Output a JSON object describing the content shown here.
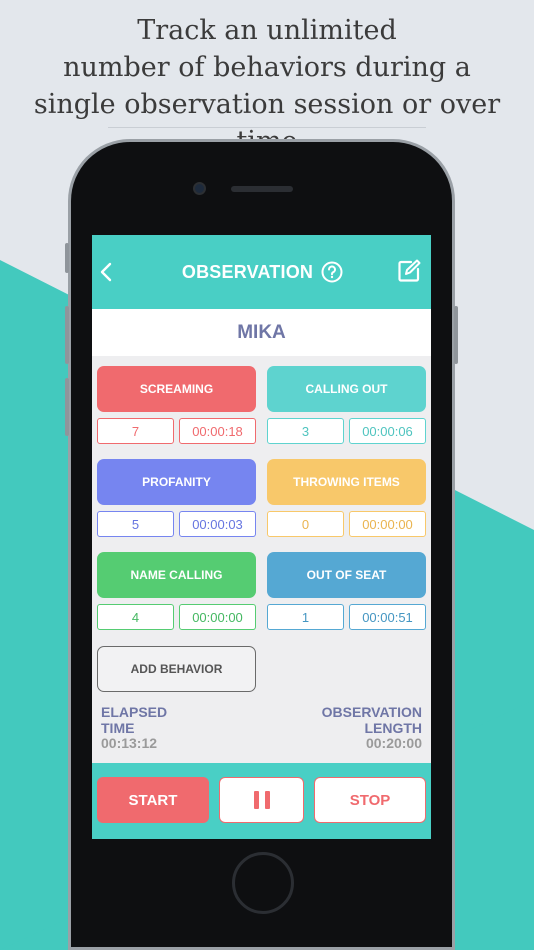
{
  "headline": {
    "line1": "Track an unlimited",
    "line2": "number of behaviors during a",
    "line3": "single observation session or over time"
  },
  "navbar": {
    "title": "OBSERVATION",
    "back_icon": "chevron-left-icon",
    "help_icon": "question-circle-icon",
    "edit_icon": "edit-note-icon"
  },
  "student": {
    "name": "MIKA"
  },
  "behaviors": [
    {
      "label": "SCREAMING",
      "count": "7",
      "duration": "00:00:18",
      "color": "#f06a6e"
    },
    {
      "label": "CALLING OUT",
      "count": "3",
      "duration": "00:00:06",
      "color": "#5ed3cf"
    },
    {
      "label": "PROFANITY",
      "count": "5",
      "duration": "00:00:03",
      "color": "#7685f0"
    },
    {
      "label": "THROWING ITEMS",
      "count": "0",
      "duration": "00:00:00",
      "color": "#f8c86a"
    },
    {
      "label": "NAME CALLING",
      "count": "4",
      "duration": "00:00:00",
      "color": "#55cc72"
    },
    {
      "label": "OUT OF SEAT",
      "count": "1",
      "duration": "00:00:51",
      "color": "#55a8d3"
    }
  ],
  "add_behavior": {
    "label": "ADD BEHAVIOR"
  },
  "elapsed": {
    "label_line1": "ELAPSED",
    "label_line2": "TIME",
    "value": "00:13:12"
  },
  "length": {
    "label_line1": "OBSERVATION",
    "label_line2": "LENGTH",
    "value": "00:20:00"
  },
  "controls": {
    "start_label": "START",
    "stop_label": "STOP",
    "pause_icon": "pause-icon"
  },
  "colors": {
    "teal": "#49cfc5",
    "accent_red": "#f06a6e",
    "label_purple": "#6f76a6"
  }
}
